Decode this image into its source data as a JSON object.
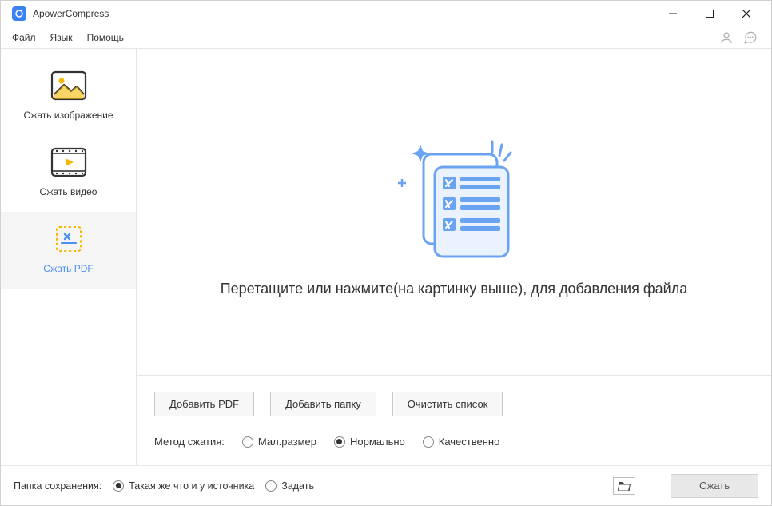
{
  "app": {
    "title": "ApowerCompress"
  },
  "menu": {
    "file": "Файл",
    "language": "Язык",
    "help": "Помощь"
  },
  "sidebar": {
    "items": [
      {
        "label": "Сжать изображение"
      },
      {
        "label": "Сжать видео"
      },
      {
        "label": "Сжать PDF"
      }
    ],
    "selected": 2
  },
  "main": {
    "drop_hint": "Перетащите или нажмите(на картинку выше), для добавления файла",
    "buttons": {
      "add_pdf": "Добавить PDF",
      "add_folder": "Добавить папку",
      "clear_list": "Очистить список"
    },
    "method": {
      "label": "Метод сжатия:",
      "options": [
        "Мал.размер",
        "Нормально",
        "Качественно"
      ],
      "selected": 1
    }
  },
  "footer": {
    "save_label": "Папка сохранения:",
    "options": [
      "Такая же что и у источника",
      "Задать"
    ],
    "selected": 0,
    "compress": "Сжать"
  }
}
